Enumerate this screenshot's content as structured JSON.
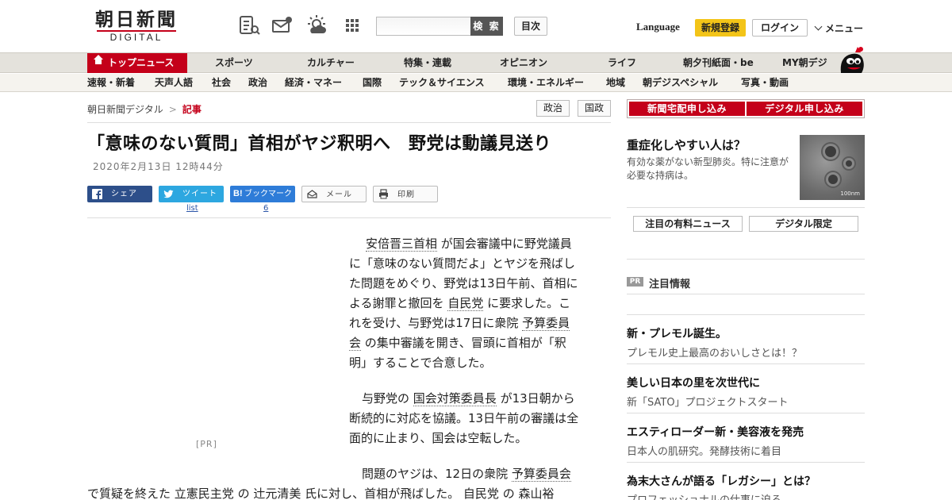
{
  "header": {
    "logo_main": "朝日新聞",
    "logo_sub": "DIGITAL",
    "search_button": "検 索",
    "index_button": "目次",
    "language": "Language",
    "register": "新規登録",
    "login": "ログイン",
    "menu": "メニュー",
    "icons": [
      "news-list-icon",
      "mail-notify-icon",
      "weather-icon",
      "grid-menu-icon"
    ]
  },
  "nav_primary": [
    {
      "label": "トップニュース",
      "active": true
    },
    {
      "label": "スポーツ"
    },
    {
      "label": "カルチャー"
    },
    {
      "label": "特集・連載"
    },
    {
      "label": "オピニオン"
    },
    {
      "label": "ライフ"
    },
    {
      "label": "朝夕刊紙面・be"
    },
    {
      "label": "MY朝デジ"
    }
  ],
  "nav_secondary": [
    {
      "label": "速報・新着"
    },
    {
      "label": "天声人語"
    },
    {
      "label": "社会"
    },
    {
      "label": "政治"
    },
    {
      "label": "経済・マネー"
    },
    {
      "label": "国際"
    },
    {
      "label": "テック＆サイエンス"
    },
    {
      "label": "環境・エネルギー"
    },
    {
      "label": "地域"
    },
    {
      "label": "朝デジスペシャル"
    },
    {
      "label": "写真・動画"
    }
  ],
  "breadcrumb": {
    "home": "朝日新聞デジタル",
    "sep": ">",
    "current": "記事"
  },
  "tags": [
    "政治",
    "国政"
  ],
  "article": {
    "headline": "「意味のない質問」首相がヤジ釈明へ　野党は動議見送り",
    "date": "2020年2月13日 12時44分",
    "pr_label": "[PR]",
    "p1": {
      "kw1": "安倍晋三首相",
      "t1": " が国会審議中に野党議員",
      "l2": "に「意味のない質問だよ」とヤジを飛ばし",
      "l3": "た問題をめぐり、野党は13日午前、首相に",
      "t4a": "よる謝罪と撤回を ",
      "kw2": "自民党",
      "t4b": " に要求した。こ",
      "t5a": "れを受け、与野党は17日に衆院 ",
      "kw3a": "予算委員",
      "kw3b": "会",
      "t6": " の集中審議を開き、冒頭に首相が「釈",
      "l7": "明」することで合意した。"
    },
    "p2": {
      "t1a": "与野党の ",
      "kw1": "国会対策委員長",
      "t1b": " が13日朝から",
      "l2": "断続的に対応を協議。13日午前の審議は全",
      "l3": "面的に止まり、国会は空転した。"
    },
    "p3": {
      "t1a": "問題のヤジは、12日の衆院 ",
      "kw1": "予算委員会",
      "t2a": "で質疑を終えた ",
      "kw2": "立憲民主党",
      "t2b": " の ",
      "kw3": "辻元清美",
      "t2c": " 氏に対し、首相が飛ばした。 ",
      "kw4": "自民党",
      "t2d": " の ",
      "kw5": "森山裕"
    }
  },
  "share": {
    "facebook": "シェア",
    "twitter": "ツイート",
    "twitter_count": "list",
    "hatena": "ブックマーク",
    "hatena_count": "6",
    "mail": "メール",
    "print": "印刷"
  },
  "sidebar": {
    "btn_paper": "新聞宅配申し込み",
    "btn_digital": "デジタル申し込み",
    "featured": {
      "title": "重症化しやすい人は？",
      "desc": "有効な薬がない新型肺炎。特に注意が必要な持病は。",
      "img_scale": "100nm"
    },
    "tab_paid": "注目の有料ニュース",
    "tab_digital": "デジタル限定",
    "pr_badge": "PR",
    "pr_title": "注目情報",
    "pr_items": [
      {
        "title": "新・プレモル誕生。",
        "sub": "プレモル史上最高のおいしさとは！？"
      },
      {
        "title": "美しい日本の里を次世代に",
        "sub": "新「SATO」プロジェクトスタート"
      },
      {
        "title": "エスティローダー新・美容液を発売",
        "sub": "日本人の肌研究。発酵技術に着目"
      },
      {
        "title": "為末大さんが語る「レガシー」とは？",
        "sub": "プロフェッショナルの仕事に迫る"
      }
    ]
  },
  "colors": {
    "brand_red": "#c4001a",
    "nav_bg": "#e4e2dc",
    "register_yellow": "#f3c418",
    "facebook": "#2d4f8a",
    "twitter": "#2da7e0",
    "hatena": "#2e7cd8"
  }
}
